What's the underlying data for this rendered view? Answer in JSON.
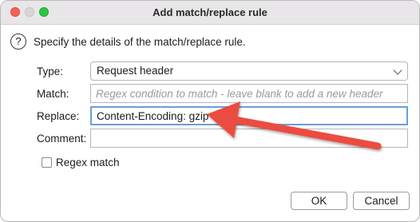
{
  "window": {
    "title": "Add match/replace rule"
  },
  "dialog": {
    "description": "Specify the details of the match/replace rule.",
    "type": {
      "label": "Type:",
      "value": "Request header"
    },
    "match": {
      "label": "Match:",
      "value": "",
      "placeholder": "Regex condition to match - leave blank to add a new header"
    },
    "replace": {
      "label": "Replace:",
      "value": "Content-Encoding: gzip"
    },
    "comment": {
      "label": "Comment:",
      "value": ""
    },
    "regex": {
      "label": "Regex match",
      "checked": false
    }
  },
  "buttons": {
    "ok": "OK",
    "cancel": "Cancel"
  },
  "icons": {
    "help": "question-circle-icon",
    "arrow": "annotation-arrow-icon"
  },
  "colors": {
    "arrow": "#ec4b41",
    "focus_border": "#6a9fd8"
  }
}
